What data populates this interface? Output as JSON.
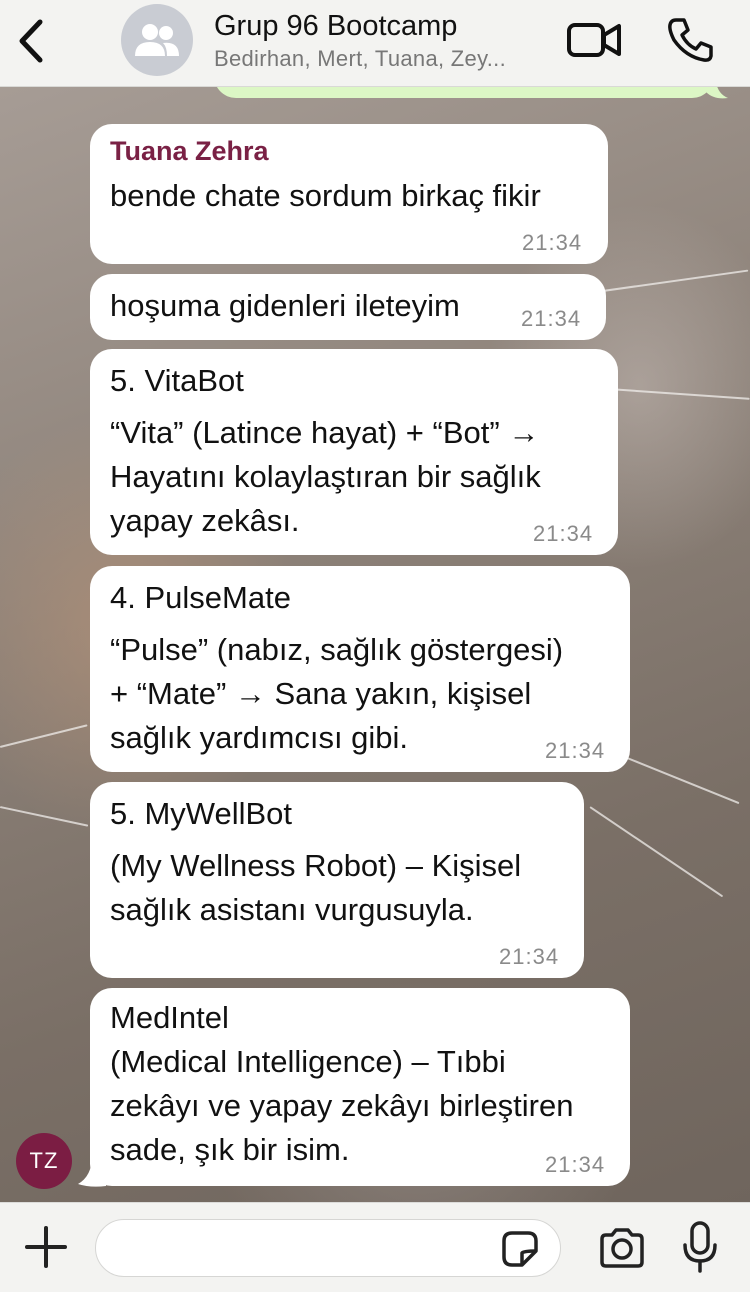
{
  "header": {
    "back_label": "Back",
    "group_title": "Grup 96 Bootcamp",
    "members": "Bedirhan, Mert, Tuana, Zey..."
  },
  "messages": [
    {
      "sender": "Tuana Zehra",
      "lines": [
        "bende chate sordum birkaç fikir"
      ],
      "time": "21:34"
    },
    {
      "lines": [
        "hoşuma gidenleri ileteyim"
      ],
      "time": "21:34"
    },
    {
      "lines": [
        "5. VitaBot",
        "“Vita” (Latince hayat) + “Bot” →",
        "Hayatını kolaylaştıran bir sağlık",
        "yapay zekâsı."
      ],
      "time": "21:34"
    },
    {
      "lines": [
        "4. PulseMate",
        "“Pulse” (nabız, sağlık göstergesi)",
        "+ “Mate” → Sana yakın, kişisel",
        "sağlık yardımcısı gibi."
      ],
      "time": "21:34"
    },
    {
      "lines": [
        "5. MyWellBot",
        "(My Wellness Robot) – Kişisel",
        "sağlık asistanı vurgusuyla."
      ],
      "time": "21:34"
    },
    {
      "lines": [
        "MedIntel",
        "(Medical Intelligence) – Tıbbi",
        "zekâyı ve yapay zekâyı birleştiren",
        "sade, şık bir isim."
      ],
      "time": "21:34"
    }
  ],
  "sender_avatar": {
    "initials": "TZ",
    "color": "#7b1d43"
  },
  "composer": {
    "value": "",
    "placeholder": ""
  },
  "colors": {
    "incoming_bubble": "#ffffff",
    "outgoing_bubble": "#dcf7c5",
    "sender_name": "#7a2145",
    "bar_background": "#f3f3f1"
  },
  "icons": [
    "chevron-left-icon",
    "group-icon",
    "video-icon",
    "phone-icon",
    "plus-icon",
    "sticker-icon",
    "camera-icon",
    "microphone-icon"
  ]
}
